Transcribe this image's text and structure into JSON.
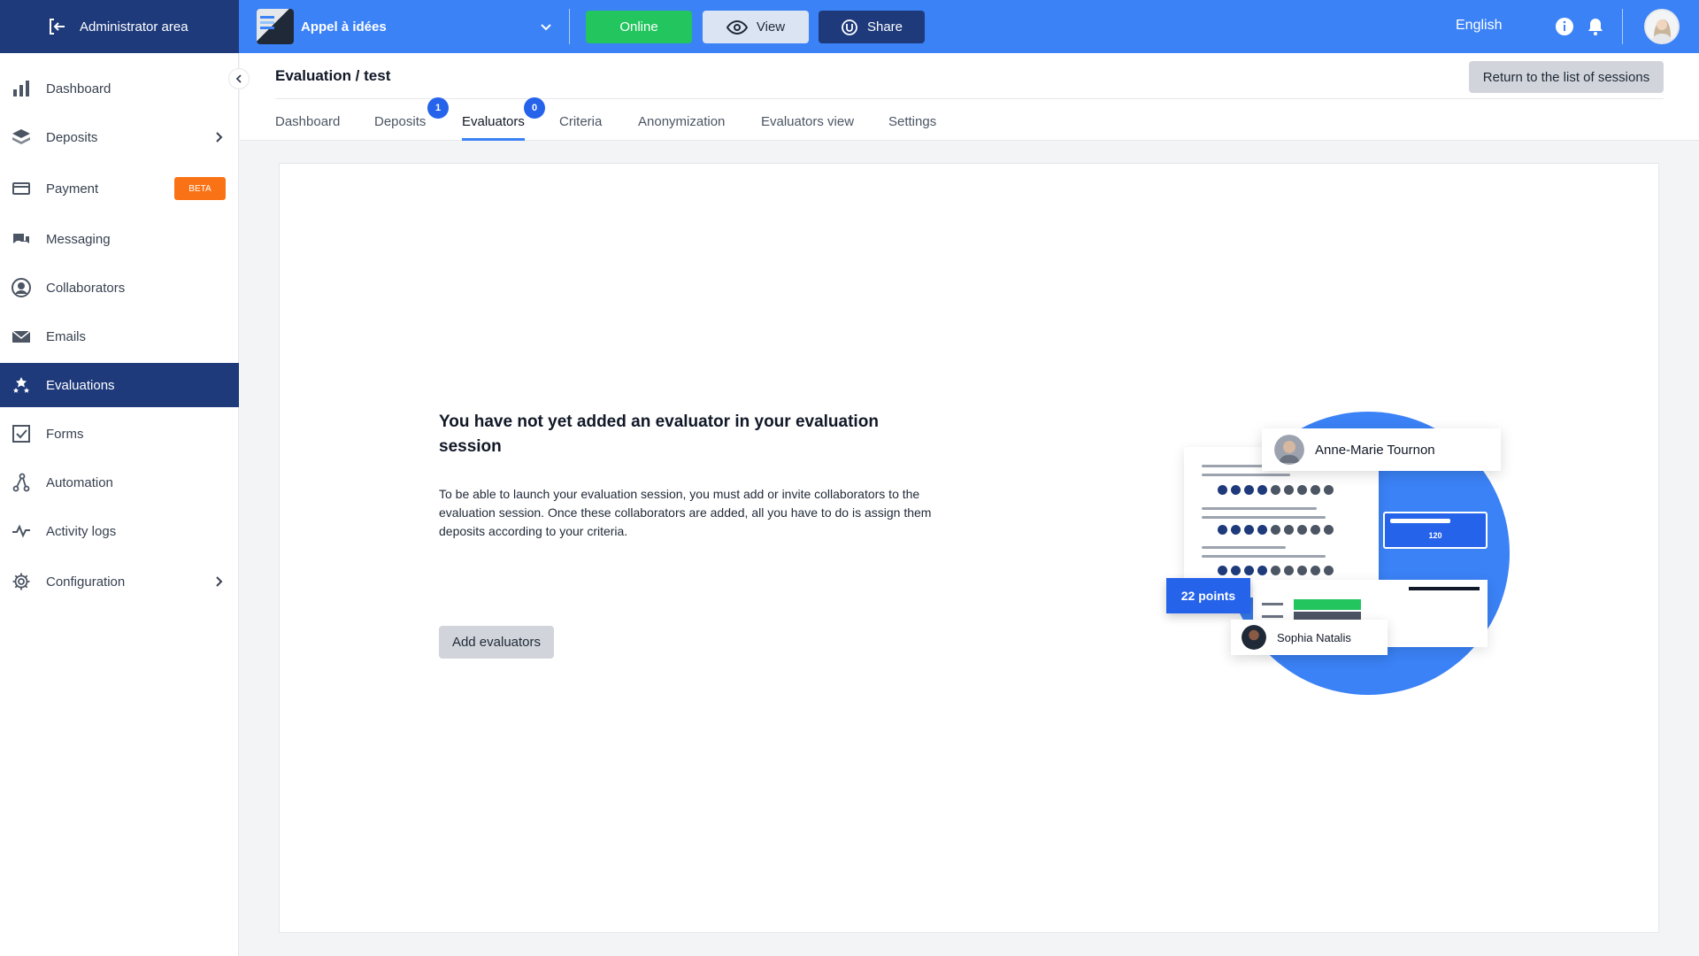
{
  "topbar": {
    "admin_label": "Administrator area",
    "project_name": "Appel à idées",
    "online_label": "Online",
    "view_label": "View",
    "share_label": "Share",
    "language": "English"
  },
  "sidebar": {
    "items": [
      {
        "label": "Dashboard",
        "icon": "bar-chart-icon"
      },
      {
        "label": "Deposits",
        "icon": "layers-icon"
      },
      {
        "label": "Payment",
        "icon": "credit-card-icon",
        "badge": "BETA"
      },
      {
        "label": "Messaging",
        "icon": "chat-icon"
      },
      {
        "label": "Collaborators",
        "icon": "user-circle-icon"
      },
      {
        "label": "Emails",
        "icon": "envelope-icon"
      },
      {
        "label": "Evaluations",
        "icon": "stars-icon"
      },
      {
        "label": "Forms",
        "icon": "checkbox-icon"
      },
      {
        "label": "Automation",
        "icon": "automation-icon"
      },
      {
        "label": "Activity logs",
        "icon": "activity-icon"
      },
      {
        "label": "Configuration",
        "icon": "gear-icon"
      }
    ]
  },
  "header": {
    "title": "Evaluation / test",
    "return_label": "Return to the list of sessions",
    "tabs": [
      {
        "label": "Dashboard"
      },
      {
        "label": "Deposits",
        "badge": "1"
      },
      {
        "label": "Evaluators",
        "badge": "0"
      },
      {
        "label": "Criteria"
      },
      {
        "label": "Anonymization"
      },
      {
        "label": "Evaluators view"
      },
      {
        "label": "Settings"
      }
    ]
  },
  "main": {
    "empty_title": "You have not yet added an evaluator in your evaluation session",
    "empty_description": "To be able to launch your evaluation session, you must add or invite collaborators to the evaluation session. Once these collaborators are added, all you have to do is assign them deposits according to your criteria.",
    "add_button": "Add evaluators"
  },
  "illustration": {
    "person1": "Anne-Marie Tournon",
    "person2": "Sophia Natalis",
    "points": "22 points",
    "score": "120"
  },
  "colors": {
    "primary": "#3b82f6",
    "navy": "#1e3a7b",
    "success": "#22c55e",
    "beta": "#f97316"
  }
}
